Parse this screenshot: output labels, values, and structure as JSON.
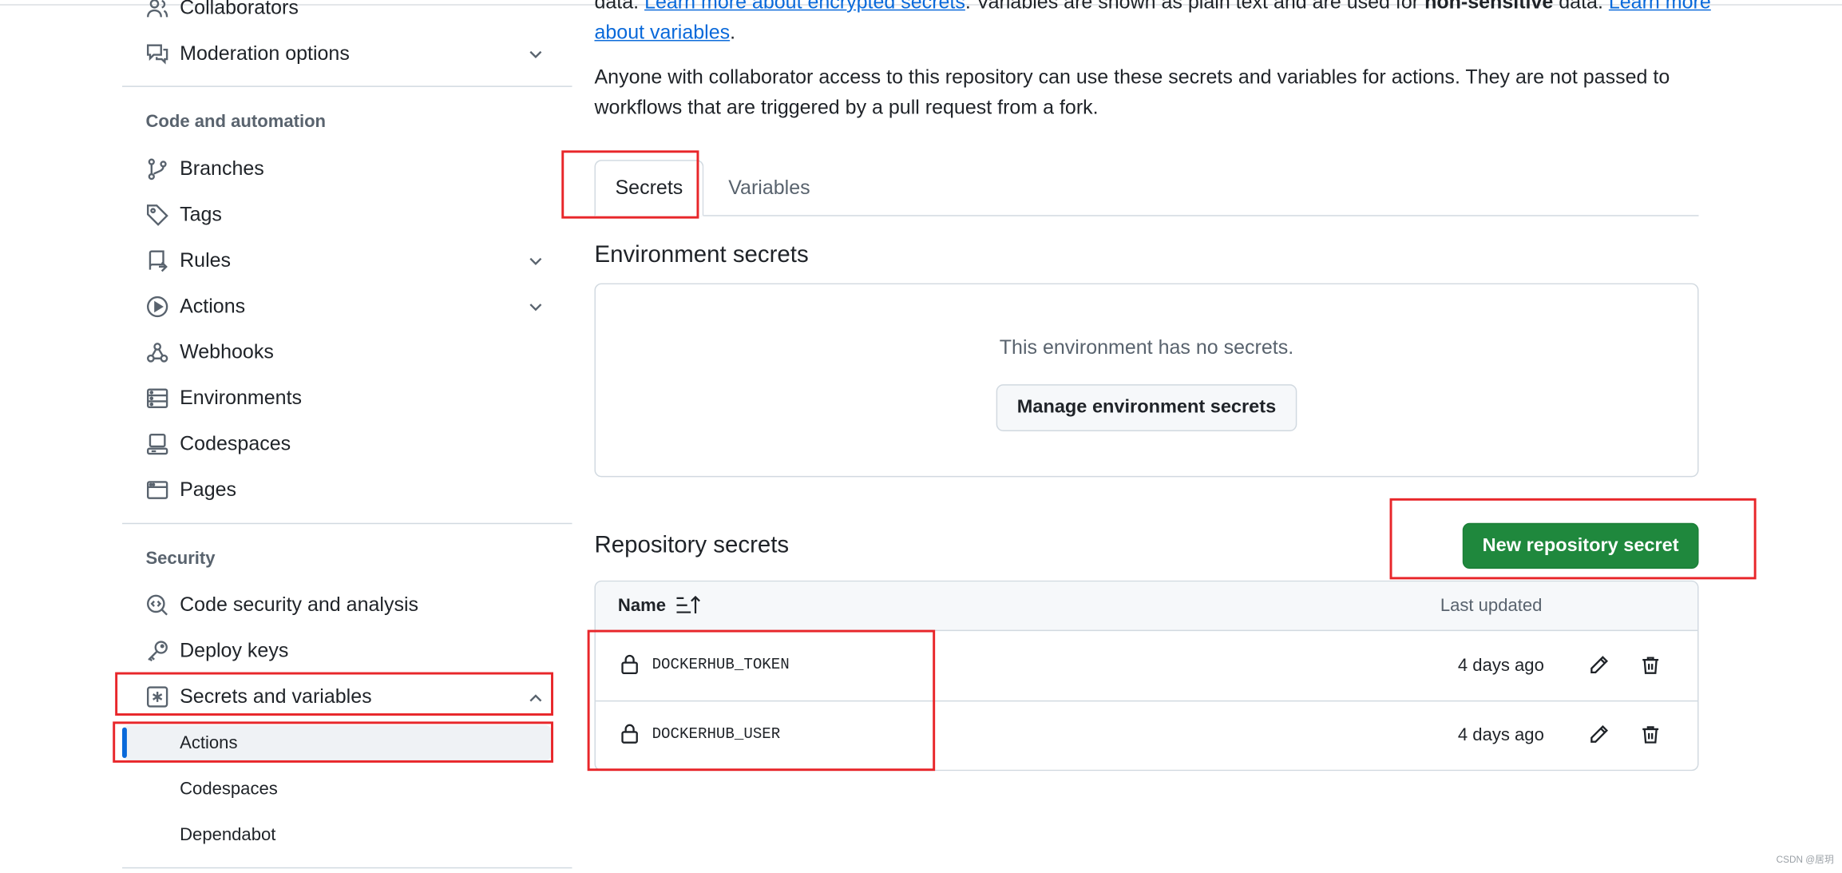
{
  "sidebar": {
    "top_items": [
      {
        "label": "Collaborators",
        "icon": "people-icon"
      },
      {
        "label": "Moderation options",
        "icon": "comment-discussion-icon"
      }
    ],
    "code_automation_heading": "Code and automation",
    "code_items": [
      {
        "label": "Branches",
        "icon": "git-branch-icon"
      },
      {
        "label": "Tags",
        "icon": "tag-icon"
      },
      {
        "label": "Rules",
        "icon": "repo-push-icon"
      },
      {
        "label": "Actions",
        "icon": "play-icon"
      },
      {
        "label": "Webhooks",
        "icon": "webhook-icon"
      },
      {
        "label": "Environments",
        "icon": "server-icon"
      },
      {
        "label": "Codespaces",
        "icon": "codespaces-icon"
      },
      {
        "label": "Pages",
        "icon": "browser-icon"
      }
    ],
    "security_heading": "Security",
    "security_items": [
      {
        "label": "Code security and analysis",
        "icon": "codescan-icon"
      },
      {
        "label": "Deploy keys",
        "icon": "key-icon"
      },
      {
        "label": "Secrets and variables",
        "icon": "key-asterisk-icon"
      }
    ],
    "sub_items": [
      "Actions",
      "Codespaces",
      "Dependabot"
    ]
  },
  "intro": {
    "line1_prefix": "data. ",
    "line1_link": "Learn more about encrypted secrets",
    "line1_mid": ". Variables are shown as plain text and are used for ",
    "line1_bold": "non-sensitive",
    "line1_suffix": " data. ",
    "line1_link2": "Learn more",
    "line2_link": "about variables",
    "line2_suffix": ".",
    "para2_line1": "Anyone with collaborator access to this repository can use these secrets and variables for actions. They are not passed to",
    "para2_line2": "workflows that are triggered by a pull request from a fork."
  },
  "tabs": [
    "Secrets",
    "Variables"
  ],
  "environment": {
    "heading": "Environment secrets",
    "empty_text": "This environment has no secrets.",
    "manage_button": "Manage environment secrets"
  },
  "repository": {
    "heading": "Repository secrets",
    "new_button": "New repository secret",
    "col_name": "Name",
    "col_updated": "Last updated",
    "rows": [
      {
        "name": "DOCKERHUB_TOKEN",
        "updated": "4 days ago"
      },
      {
        "name": "DOCKERHUB_USER",
        "updated": "4 days ago"
      }
    ]
  },
  "watermark": "CSDN @居玥",
  "colors": {
    "accent": "#0969da",
    "primary_button": "#1f883d",
    "annotation": "#e8262a"
  }
}
